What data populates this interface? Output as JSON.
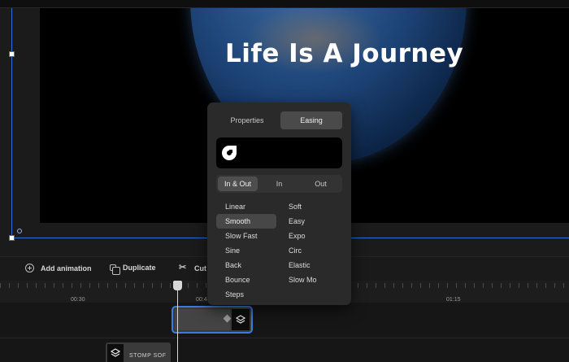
{
  "video": {
    "title": "Life Is A Journey"
  },
  "toolbar": {
    "add_animation": "Add animation",
    "duplicate": "Duplicate",
    "cut": "Cut"
  },
  "timeline": {
    "ruler_labels": [
      "00:30",
      "00:4",
      "01:15"
    ],
    "secondary_clip_name": "STOMP SOF"
  },
  "easing_panel": {
    "tabs": [
      "Properties",
      "Easing"
    ],
    "active_tab": "Easing",
    "modes": [
      "In & Out",
      "In",
      "Out"
    ],
    "active_mode": "In & Out",
    "left_column": [
      "Linear",
      "Smooth",
      "Slow Fast",
      "Sine",
      "Back",
      "Bounce",
      "Steps"
    ],
    "right_column": [
      "Soft",
      "Easy",
      "Expo",
      "Circ",
      "Elastic",
      "Slow Mo"
    ],
    "selected_easing": "Smooth"
  },
  "colors": {
    "selection_accent": "#2f6fd6",
    "panel_bg": "#2a2a2a",
    "active_item_bg": "#474747"
  },
  "icons": {
    "add_animation": "plus-circle-icon",
    "duplicate": "duplicate-icon",
    "cut": "scissors-icon",
    "clip_type": "layers-icon",
    "preview": "c-logo-icon"
  }
}
